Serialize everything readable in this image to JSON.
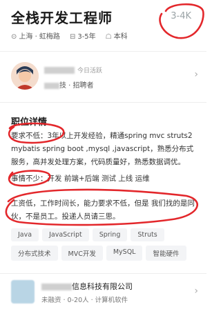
{
  "job": {
    "title": "全栈开发工程师",
    "salary": "3-4K",
    "location": "上海 · 虹梅路",
    "experience": "3-5年",
    "education": "本科"
  },
  "recruiter": {
    "active": "今日活跃",
    "role_suffix": "技 · 招聘者"
  },
  "details": {
    "section_title": "职位详情",
    "paragraph1": "要求不低：3年以上开发经验，精通spring mvc  struts2 mybatis spring boot ,mysql ,javascript，熟悉分布式服务，高并发处理方案，代码质量好，熟悉数据调优。",
    "paragraph2": "事情不少：开发 前端+后端 测试 上线 运维",
    "paragraph3": "工资低，工作时间长，能力要求不低，但是 我们找的是同伙，不是员工。投递人员请三思。"
  },
  "tags": [
    "Java",
    "JavaScript",
    "Spring",
    "Struts",
    "分布式技术",
    "MVC开发",
    "MySQL",
    "智能硬件"
  ],
  "company": {
    "name_suffix": "信息科技有限公司",
    "info": "未融资 · 0-20人 · 计算机软件"
  },
  "icons": {
    "location": "location-icon",
    "experience": "briefcase-icon",
    "education": "graduation-cap-icon",
    "chevron": "chevron-right-icon"
  },
  "colors": {
    "annotation": "#e3272b"
  }
}
